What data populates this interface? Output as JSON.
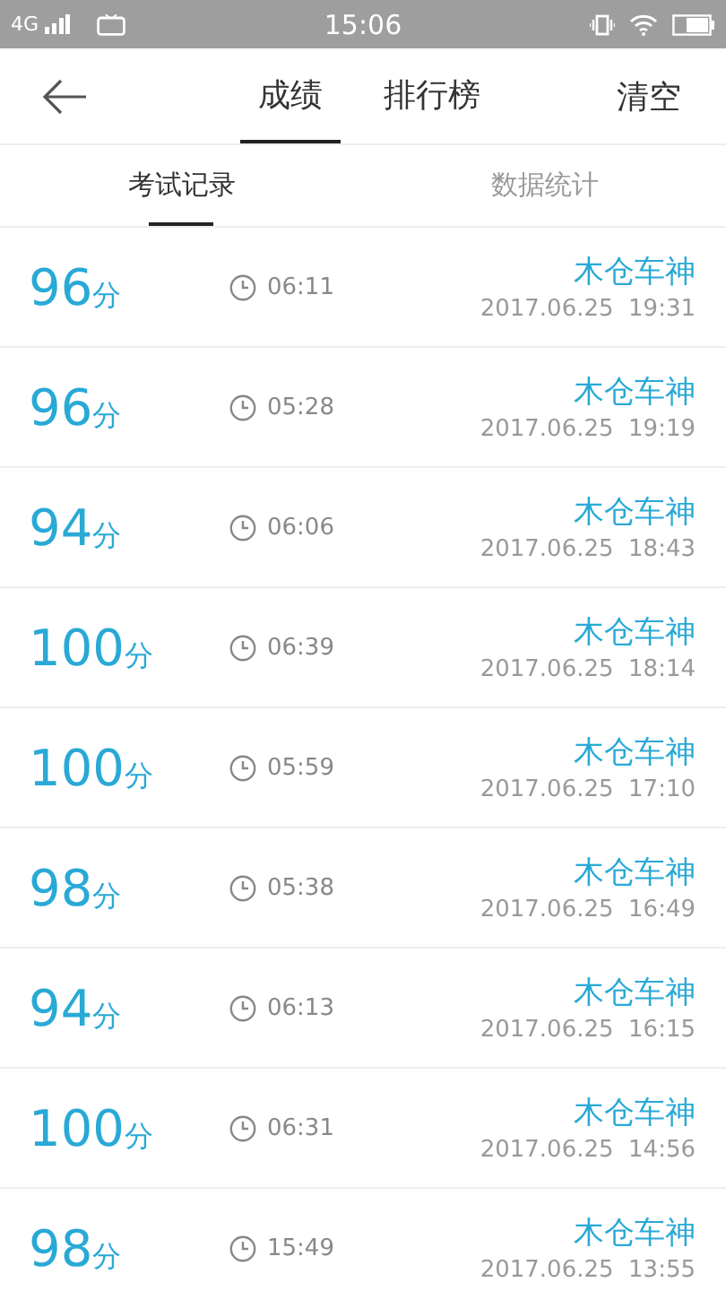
{
  "status_bar": {
    "network": "4G",
    "time": "15:06"
  },
  "header": {
    "tabs": [
      {
        "label": "成绩",
        "selected": true
      },
      {
        "label": "排行榜",
        "selected": false
      }
    ],
    "action": "清空"
  },
  "subtabs": [
    {
      "label": "考试记录",
      "selected": true
    },
    {
      "label": "数据统计",
      "selected": false
    }
  ],
  "records": [
    {
      "score": "96",
      "unit": "分",
      "duration": "06:11",
      "name": "木仓车神",
      "datetime": "2017.06.25  19:31"
    },
    {
      "score": "96",
      "unit": "分",
      "duration": "05:28",
      "name": "木仓车神",
      "datetime": "2017.06.25  19:19"
    },
    {
      "score": "94",
      "unit": "分",
      "duration": "06:06",
      "name": "木仓车神",
      "datetime": "2017.06.25  18:43"
    },
    {
      "score": "100",
      "unit": "分",
      "duration": "06:39",
      "name": "木仓车神",
      "datetime": "2017.06.25  18:14"
    },
    {
      "score": "100",
      "unit": "分",
      "duration": "05:59",
      "name": "木仓车神",
      "datetime": "2017.06.25  17:10"
    },
    {
      "score": "98",
      "unit": "分",
      "duration": "05:38",
      "name": "木仓车神",
      "datetime": "2017.06.25  16:49"
    },
    {
      "score": "94",
      "unit": "分",
      "duration": "06:13",
      "name": "木仓车神",
      "datetime": "2017.06.25  16:15"
    },
    {
      "score": "100",
      "unit": "分",
      "duration": "06:31",
      "name": "木仓车神",
      "datetime": "2017.06.25  14:56"
    },
    {
      "score": "98",
      "unit": "分",
      "duration": "15:49",
      "name": "木仓车神",
      "datetime": "2017.06.25  13:55"
    }
  ]
}
